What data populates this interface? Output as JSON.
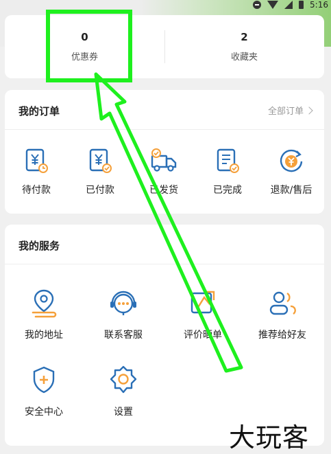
{
  "status_bar": {
    "time": "5:16"
  },
  "stats": [
    {
      "value": "0",
      "label": "优惠券"
    },
    {
      "value": "2",
      "label": "收藏夹"
    }
  ],
  "orders": {
    "title": "我的订单",
    "all_label": "全部订单",
    "items": [
      {
        "label": "待付款",
        "icon": "pending-payment-icon"
      },
      {
        "label": "已付款",
        "icon": "paid-icon"
      },
      {
        "label": "已发货",
        "icon": "shipped-truck-icon"
      },
      {
        "label": "已完成",
        "icon": "completed-icon"
      },
      {
        "label": "退款/售后",
        "icon": "refund-icon"
      }
    ]
  },
  "services": {
    "title": "我的服务",
    "items": [
      {
        "label": "我的地址",
        "icon": "location-pin-icon"
      },
      {
        "label": "联系客服",
        "icon": "customer-service-icon"
      },
      {
        "label": "评价晒单",
        "icon": "review-icon"
      },
      {
        "label": "推荐给好友",
        "icon": "recommend-friends-icon"
      },
      {
        "label": "安全中心",
        "icon": "shield-icon"
      },
      {
        "label": "设置",
        "icon": "settings-gear-icon"
      }
    ]
  },
  "colors": {
    "icon_blue": "#2a6fb6",
    "icon_orange": "#f5a03a",
    "annotation_green": "#1ef01e"
  },
  "watermark": "大玩客"
}
